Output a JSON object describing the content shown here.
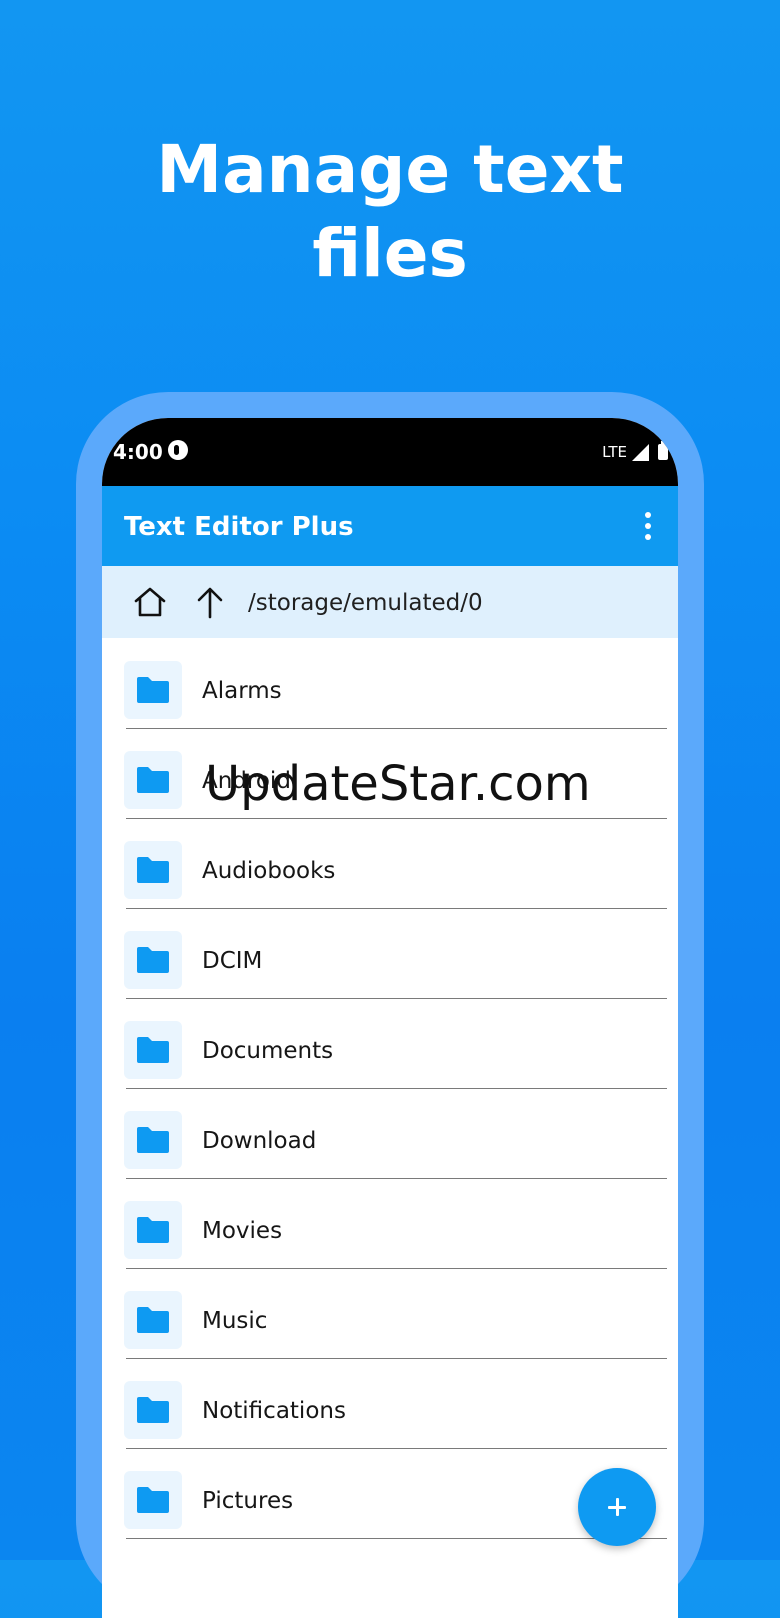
{
  "headline": {
    "line1": "Manage text",
    "line2": "files"
  },
  "status_bar": {
    "time": "4:00",
    "network": "LTE",
    "icons": [
      "app-notification-icon",
      "signal-icon",
      "battery-icon"
    ]
  },
  "app_bar": {
    "title": "Text Editor Plus",
    "menu_icon": "more-vert-icon"
  },
  "path_bar": {
    "home_icon": "home-icon",
    "up_icon": "arrow-up-icon",
    "path": "/storage/emulated/0"
  },
  "folders": [
    {
      "name": "Alarms",
      "icon": "folder-icon"
    },
    {
      "name": "Android",
      "icon": "folder-icon"
    },
    {
      "name": "Audiobooks",
      "icon": "folder-icon"
    },
    {
      "name": "DCIM",
      "icon": "folder-icon"
    },
    {
      "name": "Documents",
      "icon": "folder-icon"
    },
    {
      "name": "Download",
      "icon": "folder-icon"
    },
    {
      "name": "Movies",
      "icon": "folder-icon"
    },
    {
      "name": "Music",
      "icon": "folder-icon"
    },
    {
      "name": "Notifications",
      "icon": "folder-icon"
    },
    {
      "name": "Pictures",
      "icon": "folder-icon"
    }
  ],
  "fab": {
    "icon": "plus-icon"
  },
  "watermark": "UpdateStar.com",
  "colors": {
    "background": "#0b86f0",
    "phone_frame": "#5ba9fb",
    "app_bar": "#0f9af1",
    "path_bar": "#dff0fd",
    "folder_icon": "#0e9af2",
    "folder_tile": "#eaf5fe"
  }
}
